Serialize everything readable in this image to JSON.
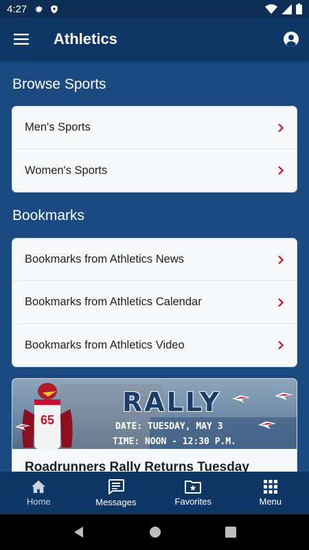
{
  "status_bar": {
    "time": "4:27"
  },
  "app_bar": {
    "title": "Athletics"
  },
  "browse": {
    "title": "Browse Sports",
    "items": [
      {
        "label": "Men's Sports"
      },
      {
        "label": "Women's Sports"
      }
    ]
  },
  "bookmarks": {
    "title": "Bookmarks",
    "items": [
      {
        "label": "Bookmarks from Athletics News"
      },
      {
        "label": "Bookmarks from Athletics Calendar"
      },
      {
        "label": "Bookmarks from Athletics Video"
      }
    ]
  },
  "promo": {
    "image_rally": "RALLY",
    "image_date": "DATE: TUESDAY, MAY 3",
    "image_time": "TIME: NOON - 12:30 P.M.",
    "image_jersey": "65",
    "title": "Roadrunners Rally Returns Tuesday"
  },
  "bottom_nav": {
    "items": [
      {
        "label": "Home",
        "icon": "home-icon",
        "active": true
      },
      {
        "label": "Messages",
        "icon": "message-icon"
      },
      {
        "label": "Favorites",
        "icon": "favorites-folder-icon"
      },
      {
        "label": "Menu",
        "icon": "grid-icon"
      }
    ]
  },
  "colors": {
    "app_bar": "#0f3766",
    "background": "#1a4a80",
    "chevron": "#c8102e",
    "card": "#f7f8fa"
  }
}
